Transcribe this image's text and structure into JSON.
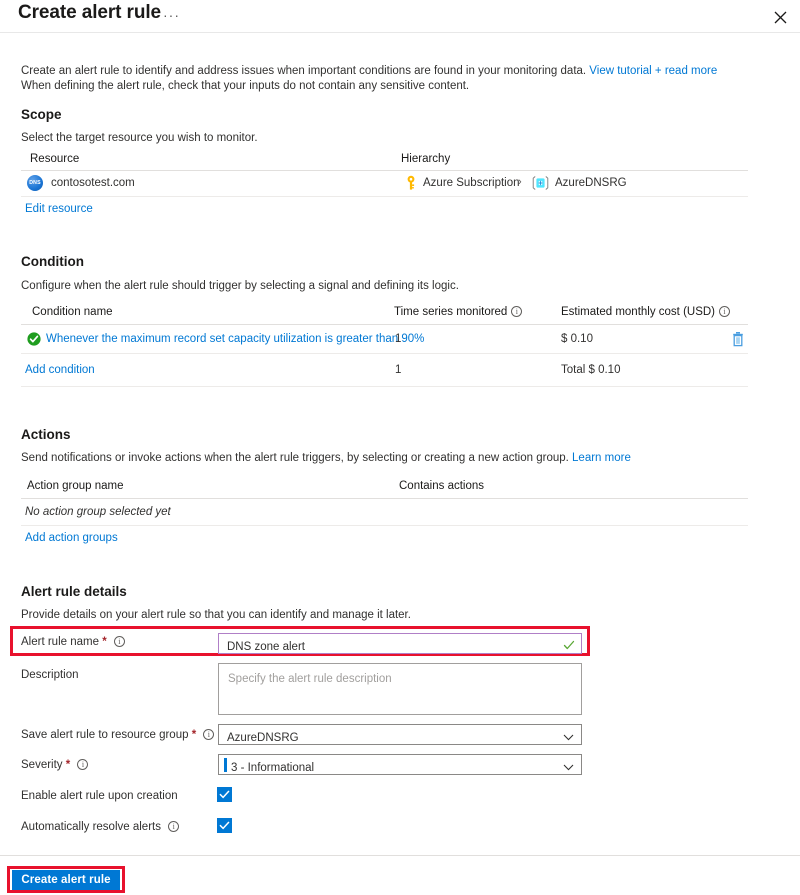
{
  "header": {
    "title": "Create alert rule",
    "ellipsis": "···",
    "close_icon": "close-icon"
  },
  "intro": {
    "line1": "Create an alert rule to identify and address issues when important conditions are found in your monitoring data. ",
    "line1_link": "View tutorial + read more",
    "line2": "When defining the alert rule, check that your inputs do not contain any sensitive content."
  },
  "scope": {
    "title": "Scope",
    "description": "Select the target resource you wish to monitor.",
    "columns": {
      "resource": "Resource",
      "hierarchy": "Hierarchy"
    },
    "row": {
      "resource_icon": "dns-zone-icon",
      "resource_icon_label": "DNS",
      "resource_name": "contosotest.com",
      "subscription_icon": "key-icon",
      "subscription": "Azure Subscription",
      "separator": "›",
      "resource_group_icon": "resource-group-icon",
      "resource_group": "AzureDNSRG"
    },
    "edit_link": "Edit resource"
  },
  "condition": {
    "title": "Condition",
    "description": "Configure when the alert rule should trigger by selecting a signal and defining its logic.",
    "columns": {
      "name": "Condition name",
      "series": "Time series monitored",
      "cost": "Estimated monthly cost (USD)"
    },
    "rows": [
      {
        "status_icon": "green-check-icon",
        "name": "Whenever the maximum record set capacity utilization is greater than 90%",
        "series": "1",
        "cost": "$ 0.10",
        "delete_icon": "trash-icon"
      }
    ],
    "add_link": "Add condition",
    "total_series": "1",
    "total_cost": "Total $ 0.10"
  },
  "actions": {
    "title": "Actions",
    "description": "Send notifications or invoke actions when the alert rule triggers, by selecting or creating a new action group. ",
    "description_link": "Learn more",
    "columns": {
      "name": "Action group name",
      "contains": "Contains actions"
    },
    "empty_text": "No action group selected yet",
    "add_link": "Add action groups"
  },
  "alert_rule_details": {
    "title": "Alert rule details",
    "description": "Provide details on your alert rule so that you can identify and manage it later.",
    "fields": {
      "name": {
        "label": "Alert rule name",
        "required": "*",
        "value": "DNS zone alert",
        "validation_icon": "green-check-icon",
        "highlighted": "true"
      },
      "description": {
        "label": "Description",
        "value": "",
        "placeholder": "Specify the alert rule description"
      },
      "resource_group": {
        "label": "Save alert rule to resource group",
        "required": "*",
        "value": "AzureDNSRG"
      },
      "severity": {
        "label": "Severity",
        "required": "*",
        "value": "3 - Informational"
      },
      "enable": {
        "label": "Enable alert rule upon creation",
        "checked": "true"
      },
      "auto_resolve": {
        "label": "Automatically resolve alerts",
        "checked": "true"
      }
    }
  },
  "footer": {
    "create_label": "Create alert rule"
  },
  "colors": {
    "accent_blue": "#0078d4",
    "link_blue": "#0078d4",
    "highlight_red": "#e8112d",
    "required_red": "#a4262c",
    "success_green": "#107c10",
    "input_focus_purple": "#b07fc7"
  }
}
